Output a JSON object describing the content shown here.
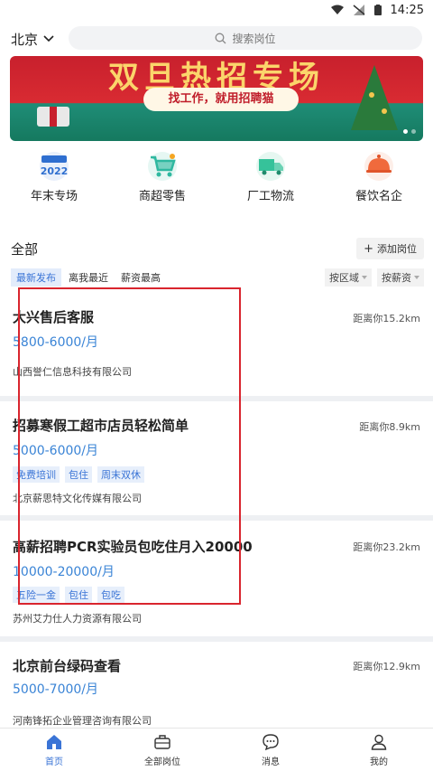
{
  "status_bar": {
    "time": "14:25"
  },
  "header": {
    "city": "北京",
    "search_placeholder": "搜索岗位"
  },
  "banner": {
    "title": "双旦热招专场",
    "subtitle": "找工作，就用招聘猫"
  },
  "categories": [
    {
      "label": "年末专场",
      "icon": "calendar-2022-icon",
      "icon_text": "2022",
      "color": "#2f6fd0"
    },
    {
      "label": "商超零售",
      "icon": "shopping-cart-icon",
      "color": "#2fb8a0"
    },
    {
      "label": "厂工物流",
      "icon": "truck-icon",
      "color": "#36c29a"
    },
    {
      "label": "餐饮名企",
      "icon": "food-cloche-icon",
      "color": "#f06a3c"
    }
  ],
  "section": {
    "title": "全部",
    "add_button": "添加岗位",
    "add_icon_text": "+"
  },
  "filters": {
    "tabs": [
      "最新发布",
      "离我最近",
      "薪资最高"
    ],
    "active_tab": 0,
    "area_label": "按区域",
    "salary_label": "按薪资"
  },
  "jobs": [
    {
      "title": "大兴售后客服",
      "distance": "距离你15.2km",
      "salary": "5800-6000/月",
      "tags": [],
      "company": "山西誉仁信息科技有限公司"
    },
    {
      "title": "招募寒假工超市店员轻松简单",
      "distance": "距离你8.9km",
      "salary": "5000-6000/月",
      "tags": [
        "免费培训",
        "包住",
        "周末双休"
      ],
      "company": "北京薪思特文化传媒有限公司"
    },
    {
      "title": "高薪招聘PCR实验员包吃住月入20000",
      "distance": "距离你23.2km",
      "salary": "10000-20000/月",
      "tags": [
        "五险一金",
        "包住",
        "包吃"
      ],
      "company": "苏州艾力仕人力资源有限公司"
    },
    {
      "title": "北京前台绿码查看",
      "distance": "距离你12.9km",
      "salary": "5000-7000/月",
      "tags": [],
      "company": "河南锋拓企业管理咨询有限公司"
    }
  ],
  "bottom_nav": [
    {
      "label": "首页",
      "icon": "home-icon",
      "active": true
    },
    {
      "label": "全部岗位",
      "icon": "briefcase-icon",
      "active": false
    },
    {
      "label": "消息",
      "icon": "message-icon",
      "active": false
    },
    {
      "label": "我的",
      "icon": "user-icon",
      "active": false
    }
  ],
  "colors": {
    "accent": "#3a74d6",
    "salary": "#3a84d6",
    "highlight_box": "#d9252e"
  }
}
